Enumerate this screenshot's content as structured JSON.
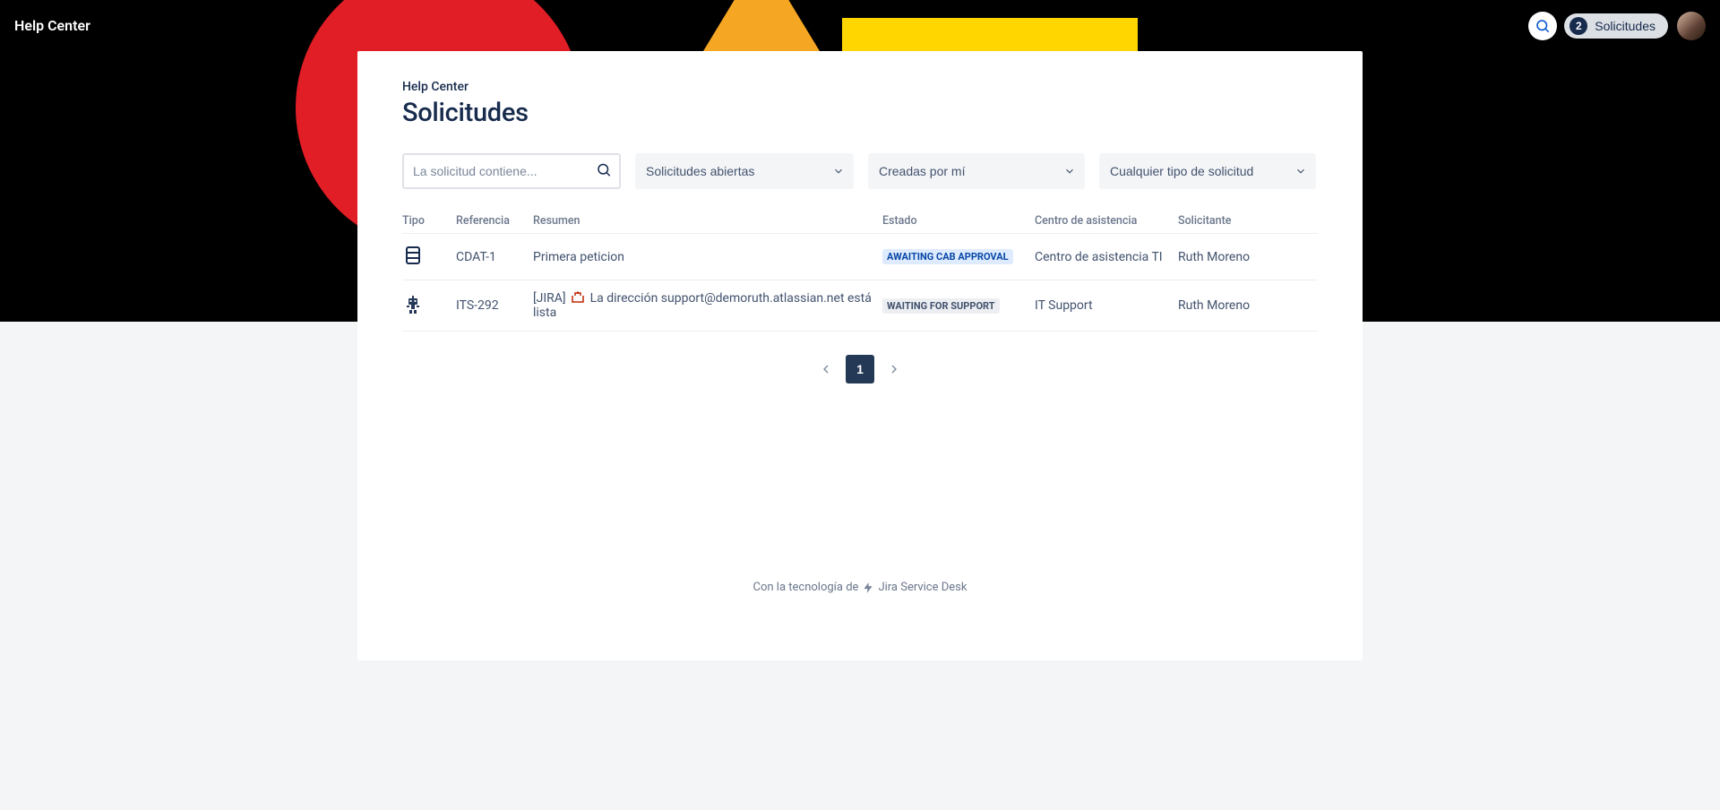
{
  "topbar": {
    "title": "Help Center",
    "requests_count": "2",
    "requests_label": "Solicitudes"
  },
  "page": {
    "breadcrumb": "Help Center",
    "heading": "Solicitudes"
  },
  "filters": {
    "search_placeholder": "La solicitud contiene...",
    "status_label": "Solicitudes abiertas",
    "creator_label": "Creadas por mí",
    "type_label": "Cualquier tipo de solicitud"
  },
  "table": {
    "headers": {
      "type": "Tipo",
      "reference": "Referencia",
      "summary": "Resumen",
      "status": "Estado",
      "service_desk": "Centro de asistencia",
      "requester": "Solicitante"
    },
    "rows": [
      {
        "type_icon": "change-icon",
        "reference": "CDAT-1",
        "summary": "Primera peticion",
        "status": "AWAITING CAB APPROVAL",
        "status_variant": "blue",
        "service_desk": "Centro de asistencia TI",
        "requester": "Ruth Moreno"
      },
      {
        "type_icon": "support-bot-icon",
        "reference": "ITS-292",
        "summary_prefix": "[JIRA] ",
        "summary_suffix": " La dirección support@demoruth.atlassian.net está lista",
        "status": "WAITING FOR SUPPORT",
        "status_variant": "grey",
        "service_desk": "IT Support",
        "requester": "Ruth Moreno"
      }
    ]
  },
  "pagination": {
    "page": "1"
  },
  "footer": {
    "powered_by": "Con la tecnología de",
    "product": "Jira Service Desk"
  }
}
